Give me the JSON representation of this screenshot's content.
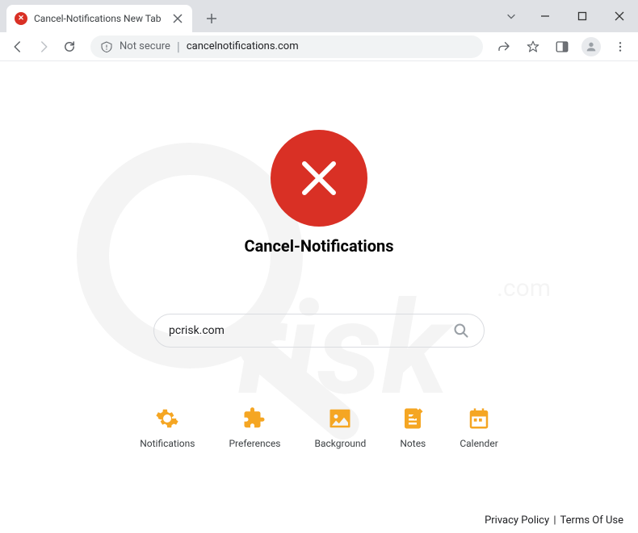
{
  "tab": {
    "title": "Cancel-Notifications New Tab"
  },
  "address": {
    "security_label": "Not secure",
    "url": "cancelnotifications.com"
  },
  "page": {
    "brand_title": "Cancel-Notifications",
    "search_value": "pcrisk.com"
  },
  "quicklinks": [
    {
      "label": "Notifications"
    },
    {
      "label": "Preferences"
    },
    {
      "label": "Background"
    },
    {
      "label": "Notes"
    },
    {
      "label": "Calender"
    }
  ],
  "footer": {
    "privacy": "Privacy Policy",
    "terms": "Terms Of Use"
  }
}
